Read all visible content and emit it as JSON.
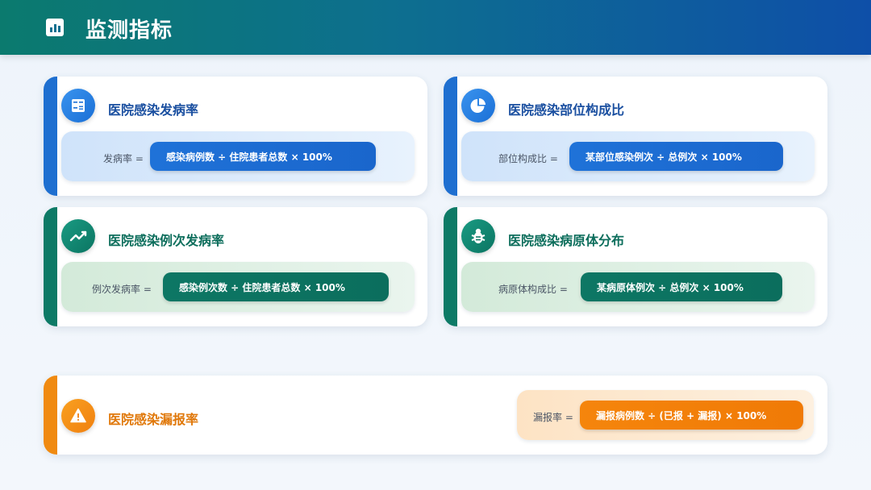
{
  "header": {
    "title": "监测指标",
    "icon": "bar-chart-icon"
  },
  "cards": [
    {
      "title": "医院感染发病率",
      "icon": "calculator-icon",
      "label": "发病率 =",
      "formula": "感染病例数 ÷ 住院患者总数 × 100%"
    },
    {
      "title": "医院感染部位构成比",
      "icon": "pie-chart-icon",
      "label": "部位构成比 =",
      "formula": "某部位感染例次 ÷ 总例次 × 100%"
    },
    {
      "title": "医院感染例次发病率",
      "icon": "trend-line-icon",
      "label": "例次发病率 =",
      "formula": "感染例次数 ÷ 住院患者总数 × 100%"
    },
    {
      "title": "医院感染病原体分布",
      "icon": "bug-icon",
      "label": "病原体构成比 =",
      "formula": "某病原体例次 ÷ 总例次 × 100%"
    },
    {
      "title": "医院感染漏报率",
      "icon": "warning-icon",
      "label": "漏报率 =",
      "formula": "漏报病例数 ÷ (已报 + 漏报) × 100%"
    }
  ],
  "colors": {
    "blue": "#1e6fd0",
    "green": "#0d7a66",
    "orange": "#f08a10"
  }
}
